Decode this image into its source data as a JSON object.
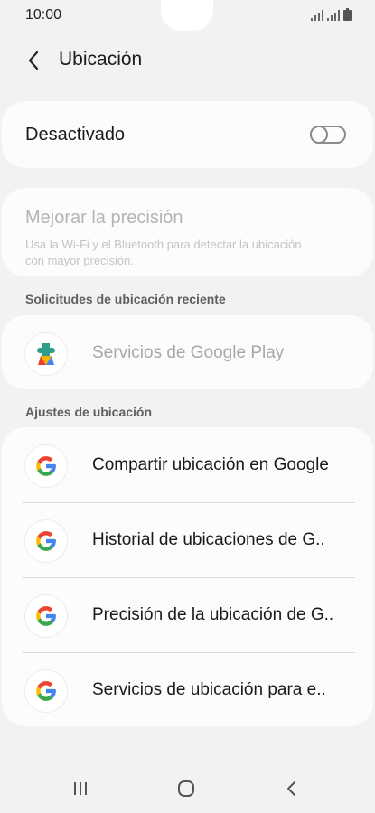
{
  "status_bar": {
    "time": "10:00"
  },
  "header": {
    "title": "Ubicación"
  },
  "location_toggle": {
    "label": "Desactivado",
    "state": "off"
  },
  "precision": {
    "title": "Mejorar la precisión",
    "description": "Usa la Wi-Fi y el Bluetooth para detectar la ubicación con mayor precisión."
  },
  "recent_requests": {
    "header": "Solicitudes de ubicación reciente",
    "items": [
      {
        "label": "Servicios de Google Play",
        "icon": "google-play-services-icon"
      }
    ]
  },
  "location_settings": {
    "header": "Ajustes de ubicación",
    "items": [
      {
        "label": "Compartir ubicación en Google",
        "icon": "google-icon"
      },
      {
        "label": "Historial de ubicaciones de G..",
        "icon": "google-icon"
      },
      {
        "label": "Precisión de la ubicación de G..",
        "icon": "google-icon"
      },
      {
        "label": "Servicios de ubicación para e..",
        "icon": "google-icon"
      }
    ]
  },
  "colors": {
    "background": "#f2f2f2",
    "card": "#fcfcfc",
    "disabled_text": "#b4b4b4",
    "google_blue": "#4285F4",
    "google_red": "#EA4335",
    "google_yellow": "#FBBC05",
    "google_green": "#34A853"
  }
}
